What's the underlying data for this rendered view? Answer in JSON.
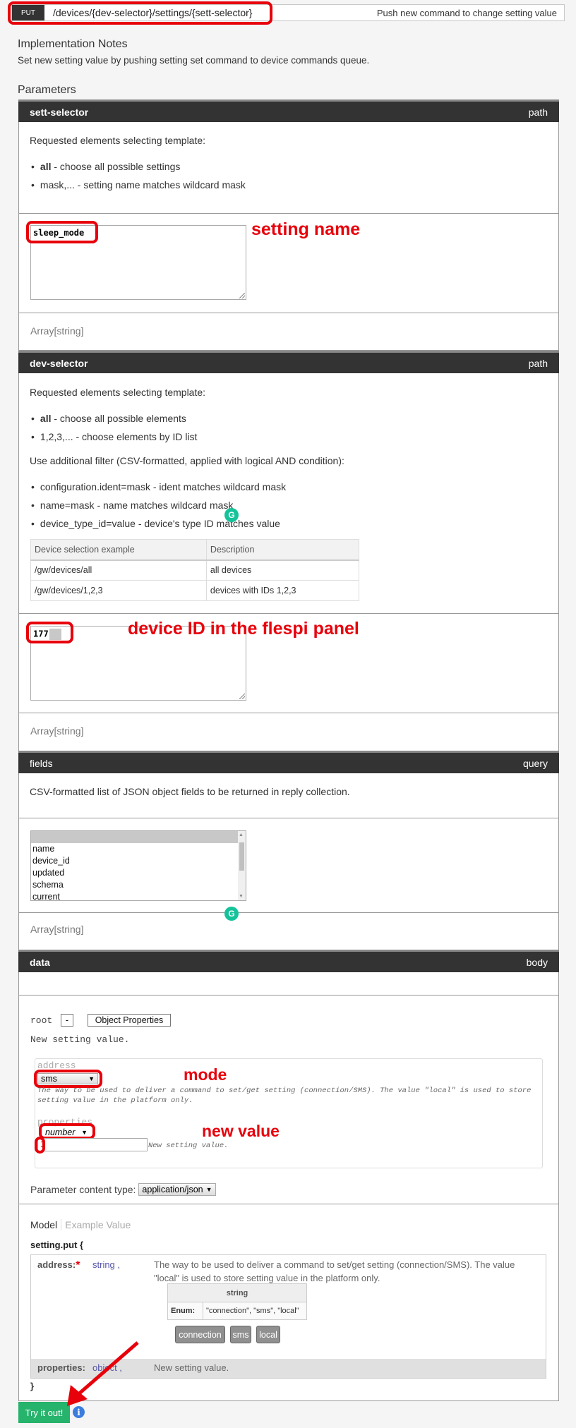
{
  "operation": {
    "method": "PUT",
    "path": "/devices/{dev-selector}/settings/{sett-selector}",
    "summary": "Push new command to change setting value"
  },
  "implementation_notes": {
    "title": "Implementation Notes",
    "text": "Set new setting value by pushing setting set command to device commands queue."
  },
  "parameters_title": "Parameters",
  "params": {
    "sett_selector": {
      "name": "sett-selector",
      "location": "path",
      "description": "Requested elements selecting template:",
      "bullets": [
        {
          "bold": "all",
          "text": " - choose all possible settings"
        },
        {
          "bold": "",
          "text": "mask,... - setting name matches wildcard mask"
        }
      ],
      "value": "sleep_mode",
      "type": "Array[string]"
    },
    "dev_selector": {
      "name": "dev-selector",
      "location": "path",
      "description": "Requested elements selecting template:",
      "bullets": [
        {
          "bold": "all",
          "text": " - choose all possible elements"
        },
        {
          "bold": "",
          "text": "1,2,3,... - choose elements by ID list"
        }
      ],
      "filter_intro": "Use additional filter (CSV-formatted, applied with logical AND condition):",
      "filters": [
        "configuration.ident=mask - ident matches wildcard mask",
        "name=mask - name matches wildcard mask",
        "device_type_id=value - device's type ID matches value"
      ],
      "table": {
        "headers": [
          "Device selection example",
          "Description"
        ],
        "rows": [
          [
            "/gw/devices/all",
            "all devices"
          ],
          [
            "/gw/devices/1,2,3",
            "devices with IDs 1,2,3"
          ]
        ]
      },
      "value_visible": "177",
      "type": "Array[string]"
    },
    "fields": {
      "name": "fields",
      "location": "query",
      "description": "CSV-formatted list of JSON object fields to be returned in reply collection.",
      "options": [
        "",
        "name",
        "device_id",
        "updated",
        "schema",
        "current"
      ],
      "type": "Array[string]"
    },
    "data": {
      "name": "data",
      "location": "body",
      "root_label": "root",
      "collapse_label": "-",
      "object_properties_label": "Object Properties",
      "object_description": "New setting value.",
      "address_label": "address",
      "address_value": "sms",
      "address_hint": "The way to be used to deliver a command to set/get setting (connection/SMS). The value \"local\" is used to store setting value in the platform only.",
      "properties_label": "properties",
      "properties_type": "number",
      "properties_value": "1",
      "properties_hint": "New setting value.",
      "content_type_label": "Parameter content type:",
      "content_type_value": "application/json"
    }
  },
  "model": {
    "tab_model": "Model",
    "tab_example": "Example Value",
    "name": "setting.put {",
    "address": {
      "name": "address:",
      "required_mark": "*",
      "type": "string ,",
      "description": "The way to be used to deliver a command to set/get setting (connection/SMS). The value \"local\" is used to store setting value in the platform only.",
      "enum_header": "string",
      "enum_label": "Enum:",
      "enum_values": "\"connection\", \"sms\", \"local\"",
      "buttons": [
        "connection",
        "sms",
        "local"
      ]
    },
    "properties": {
      "name": "properties:",
      "type": "object ,",
      "description": "New setting value."
    },
    "close": "}"
  },
  "actions": {
    "try_it_out": "Try it out!"
  },
  "annotations": {
    "setting_name": "setting name",
    "device_id": "device ID in the flespi panel",
    "mode": "mode",
    "new_value": "new value"
  },
  "colors": {
    "highlight": "#e8000b",
    "header_dark": "#333333",
    "try_button": "#26b36c",
    "info_icon": "#3b7ddd"
  }
}
